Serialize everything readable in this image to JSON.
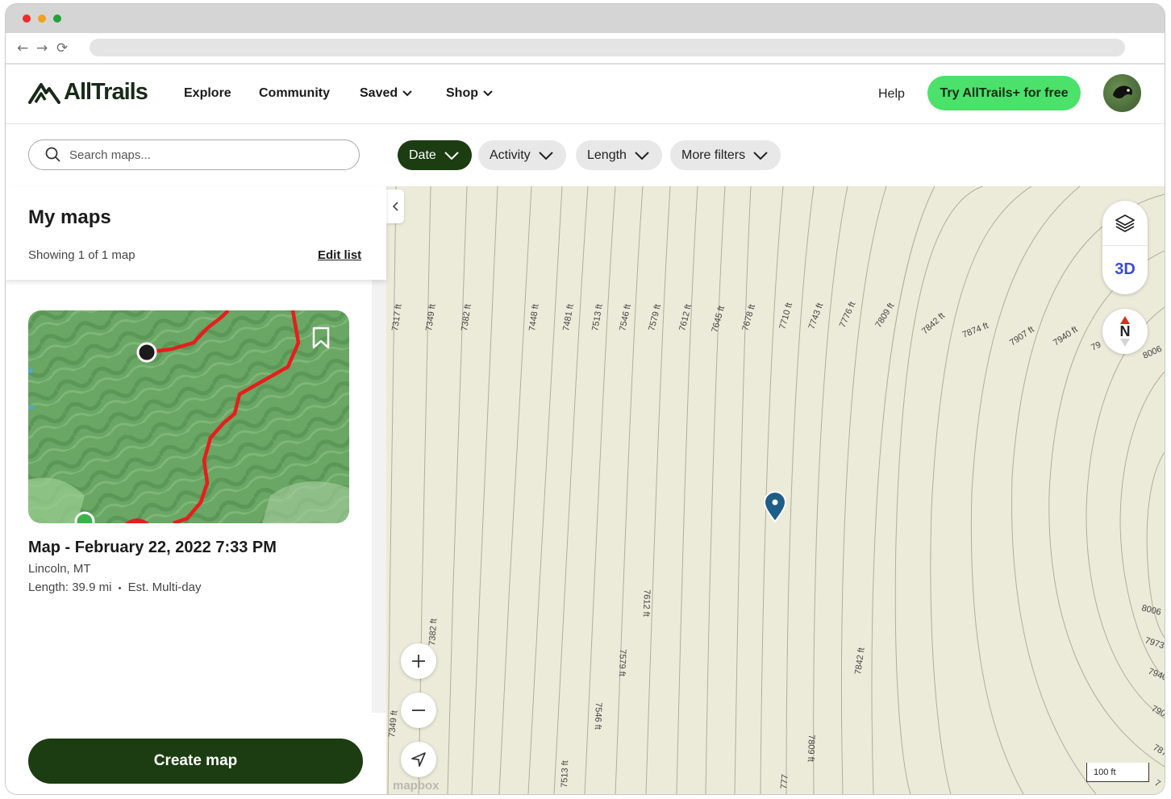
{
  "browser": {
    "back": "←",
    "forward": "→",
    "reload": "⟳"
  },
  "header": {
    "logo": "AllTrails",
    "nav": [
      {
        "label": "Explore"
      },
      {
        "label": "Community"
      },
      {
        "label": "Saved"
      },
      {
        "label": "Shop"
      }
    ],
    "help": "Help",
    "cta": "Try AllTrails+ for free"
  },
  "filters": {
    "search_placeholder": "Search maps...",
    "chips": [
      {
        "label": "Date",
        "active": true
      },
      {
        "label": "Activity",
        "active": false
      },
      {
        "label": "Length",
        "active": false
      },
      {
        "label": "More filters",
        "active": false
      }
    ]
  },
  "sidebar": {
    "title": "My maps",
    "count": "Showing 1 of 1 map",
    "edit": "Edit list",
    "card": {
      "title": "Map - February 22, 2022 7:33 PM",
      "location": "Lincoln, MT",
      "length": "Length: 39.9 mi",
      "separator": "•",
      "duration": "Est. Multi-day"
    },
    "create": "Create map"
  },
  "map": {
    "three_d": "3D",
    "north": "N",
    "scale": "100 ft",
    "attribution": "mapbox",
    "top_labels": [
      "7317 ft",
      "7349 ft",
      "7382 ft",
      "7448 ft",
      "7481 ft",
      "7513 ft",
      "7546 ft",
      "7579 ft",
      "7612 ft",
      "7645 ft",
      "7678 ft",
      "7710 ft",
      "7743 ft",
      "7776 ft",
      "7809 ft",
      "7842 ft",
      "7874 ft",
      "7907 ft",
      "7940 ft",
      "79",
      "8006"
    ],
    "lower_labels": [
      "7382 ft",
      "7612 ft",
      "7579 ft",
      "7546 ft",
      "7349 ft",
      "7513 ft",
      "7842 ft",
      "7809 ft",
      "777"
    ],
    "right_labels": [
      "8006",
      "7973",
      "7940",
      "790",
      "787",
      "7"
    ]
  },
  "colors": {
    "brand_dark": "#1c3d12",
    "cta_green": "#4be16b",
    "route_red": "#e81d1d",
    "pin_blue": "#1f5e86"
  }
}
